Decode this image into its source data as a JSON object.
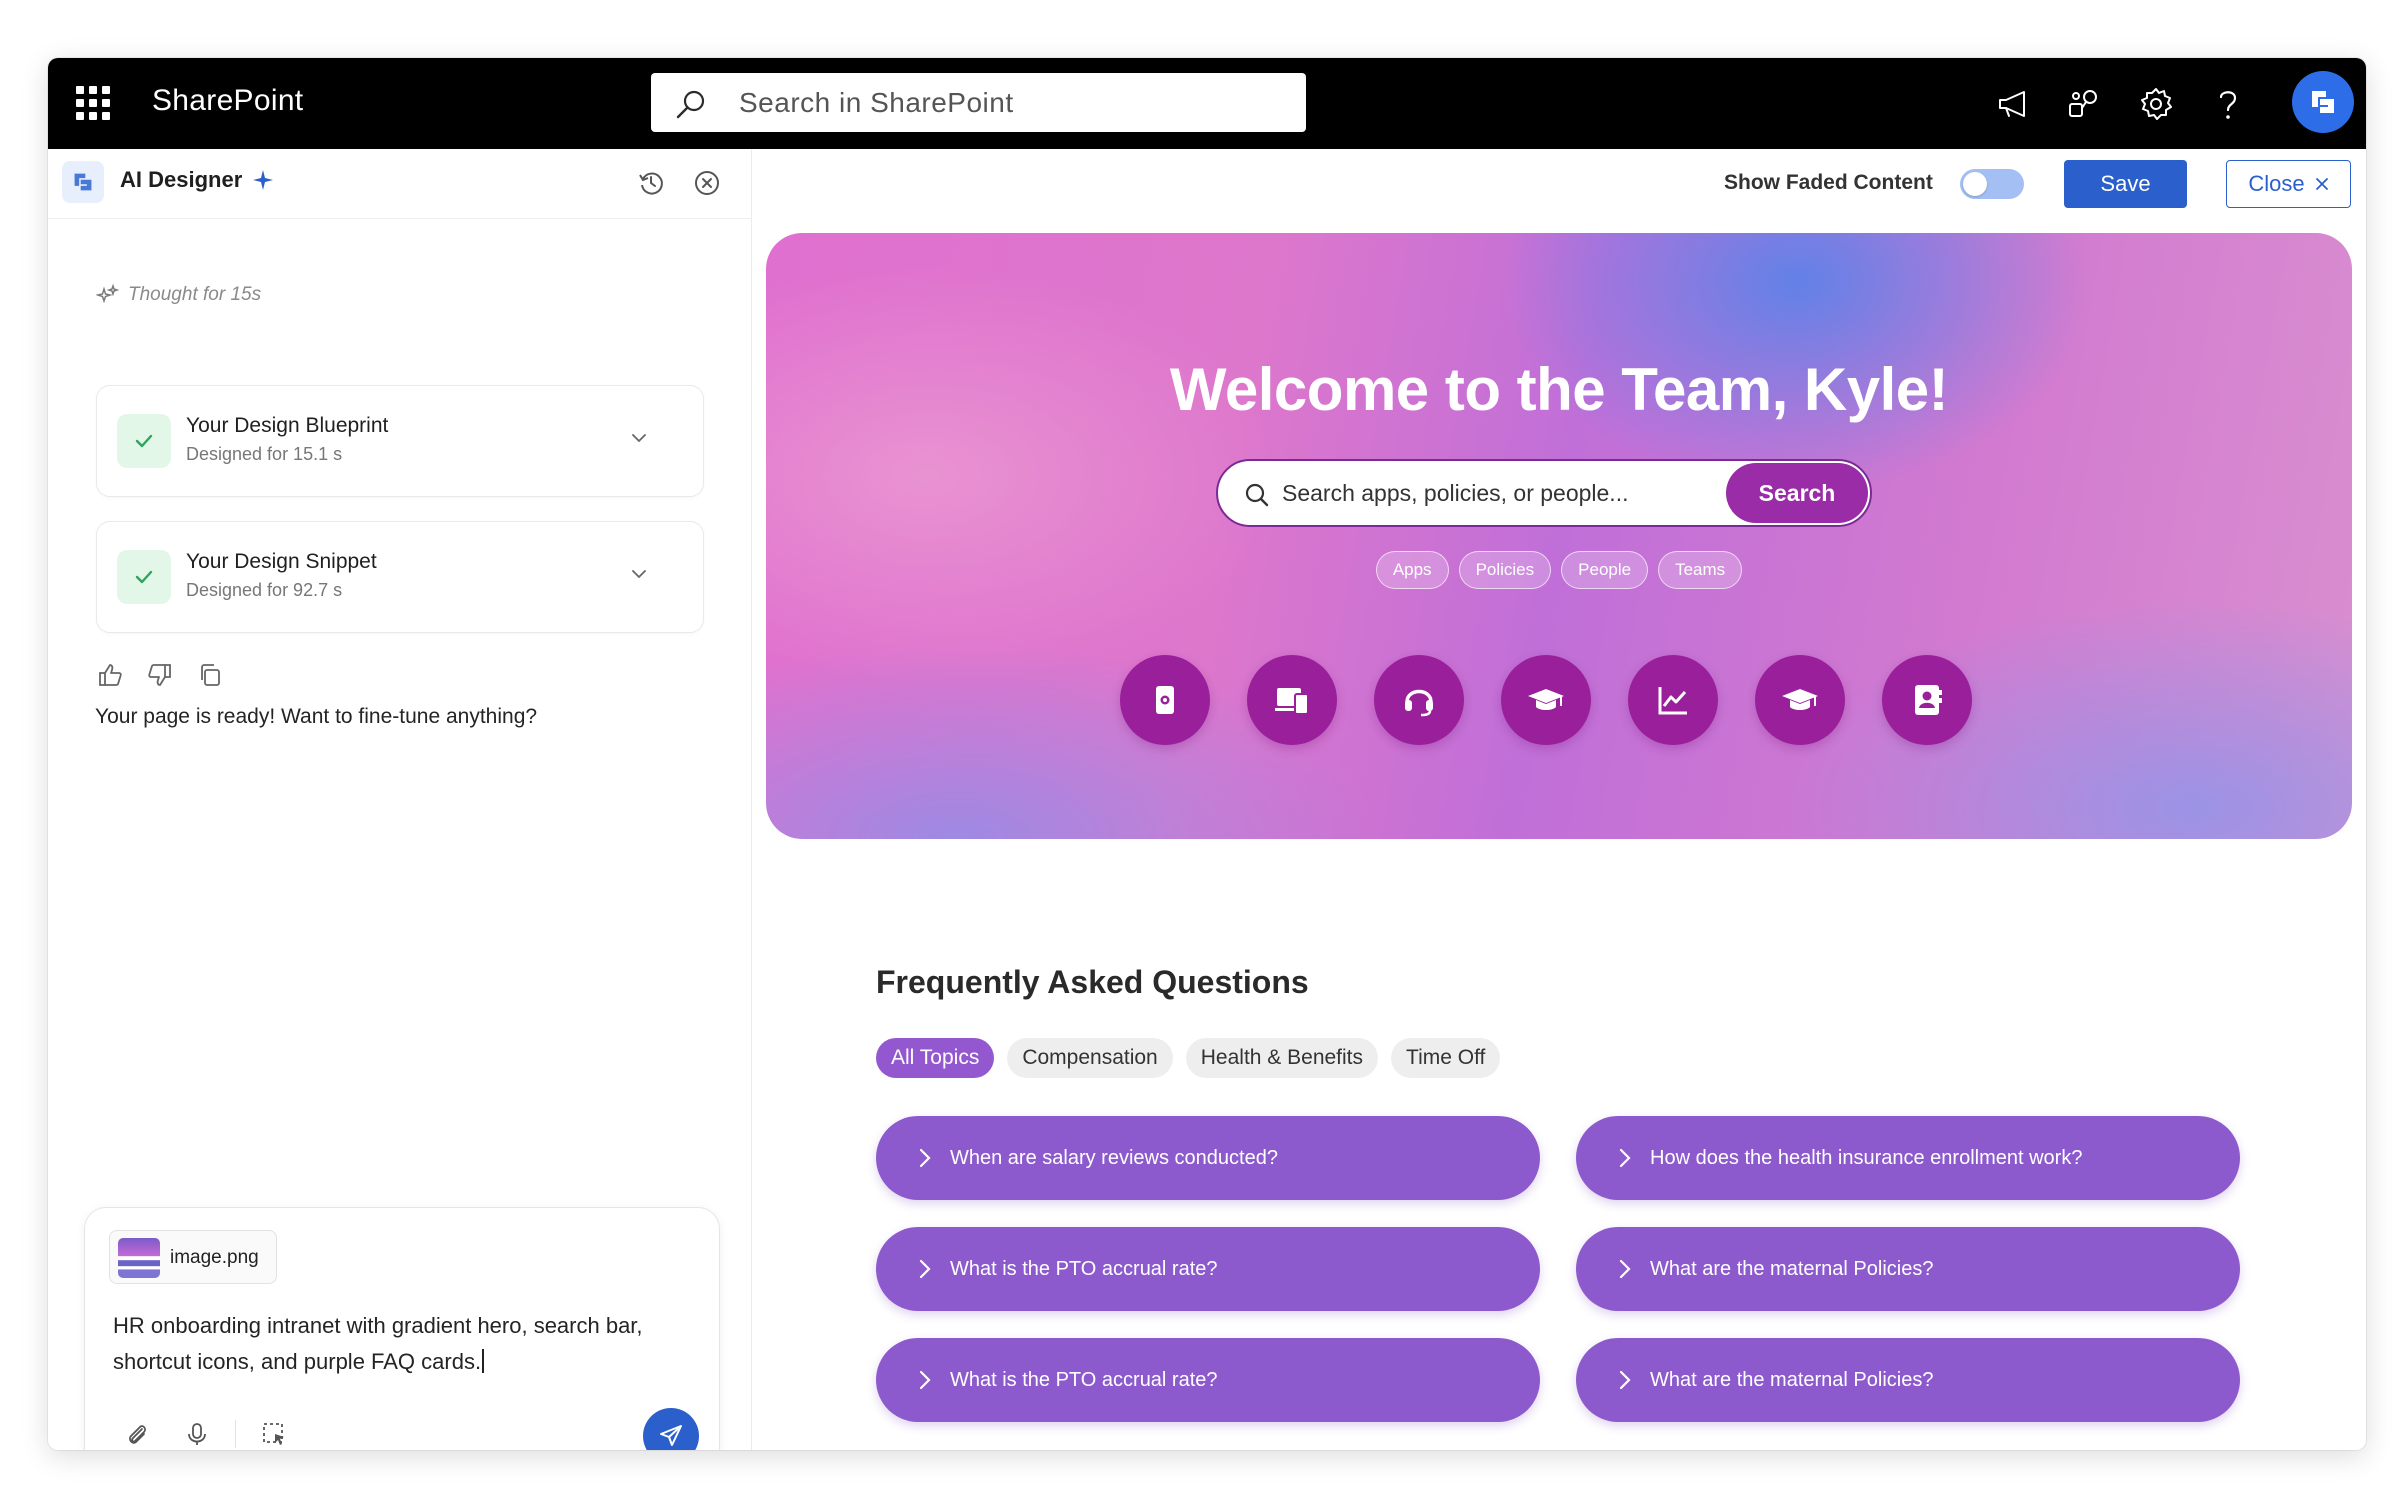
{
  "topbar": {
    "brand": "SharePoint",
    "search_placeholder": "Search in SharePoint",
    "icons": [
      "megaphone-icon",
      "share-icon",
      "gear-icon",
      "help-icon",
      "avatar"
    ]
  },
  "ai_panel": {
    "title": "AI Designer",
    "thought": "Thought for 15s",
    "steps": [
      {
        "title": "Your Design Blueprint",
        "subtitle": "Designed for 15.1 s"
      },
      {
        "title": "Your Design Snippet",
        "subtitle": "Designed for 92.7 s"
      }
    ],
    "ready_message": "Your page is ready! Want to fine-tune anything?",
    "composer": {
      "attachment_name": "image.png",
      "prompt_text": "HR onboarding intranet with gradient hero, search bar, shortcut icons, and purple FAQ cards."
    }
  },
  "toolbar": {
    "faded_label": "Show Faded Content",
    "faded_on": false,
    "save_label": "Save",
    "close_label": "Close"
  },
  "hero": {
    "title": "Welcome to the Team, Kyle!",
    "search_placeholder": "Search apps, policies, or people...",
    "search_button": "Search",
    "chips": [
      "Apps",
      "Policies",
      "People",
      "Teams"
    ],
    "shortcuts": [
      "policy-gear-icon",
      "devices-icon",
      "headset-icon",
      "graduation-cap-icon",
      "chart-icon",
      "graduation-cap-icon",
      "contact-card-icon"
    ]
  },
  "faq": {
    "title": "Frequently Asked Questions",
    "tabs": [
      "All Topics",
      "Compensation",
      "Health & Benefits",
      "Time Off"
    ],
    "active_tab": 0,
    "items": [
      "When are salary reviews conducted?",
      "How does the health insurance enrollment work?",
      "What is the PTO accrual rate?",
      "What are the maternal Policies?",
      "What is the PTO accrual rate?",
      "What are the maternal Policies?"
    ]
  },
  "colors": {
    "brand_blue": "#2b5fcb",
    "faq_purple": "#8d5acd",
    "shortcut_purple": "#9a1f9a",
    "hero_search_button": "#9a2ca8"
  }
}
